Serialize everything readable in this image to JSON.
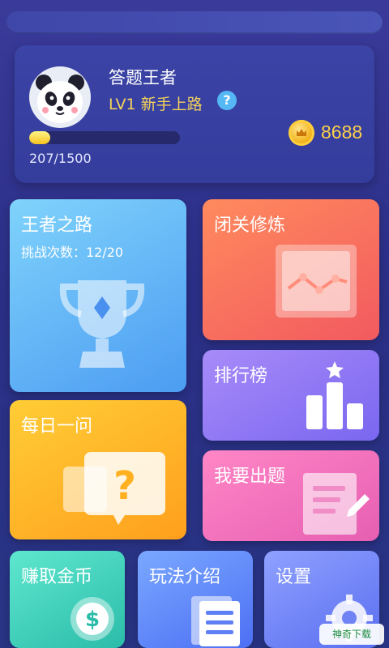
{
  "profile": {
    "nickname": "答题王者",
    "level_label": "LV1  新手上路",
    "help_symbol": "?",
    "progress_text": "207/1500",
    "progress_current": 207,
    "progress_max": 1500,
    "coin_count": "8688",
    "avatar_icon": "panda-avatar-icon"
  },
  "cards": {
    "road": {
      "title": "王者之路",
      "sub": "挑战次数：12/20",
      "icon": "trophy-icon"
    },
    "retreat": {
      "title": "闭关修炼",
      "icon": "line-chart-icon"
    },
    "ranking": {
      "title": "排行榜",
      "icon": "podium-icon"
    },
    "daily": {
      "title": "每日一问",
      "icon": "question-bubble-icon"
    },
    "submit": {
      "title": "我要出题",
      "icon": "edit-document-icon"
    },
    "earn": {
      "title": "赚取金币",
      "icon": "dollar-coin-icon"
    },
    "rules": {
      "title": "玩法介绍",
      "icon": "document-list-icon"
    },
    "settings": {
      "title": "设置",
      "icon": "gear-icon"
    }
  },
  "watermark": {
    "text": "神奇下载"
  },
  "colors": {
    "background": "#2b2f86",
    "gold": "#ffd04a",
    "level": "#f5d35a"
  }
}
